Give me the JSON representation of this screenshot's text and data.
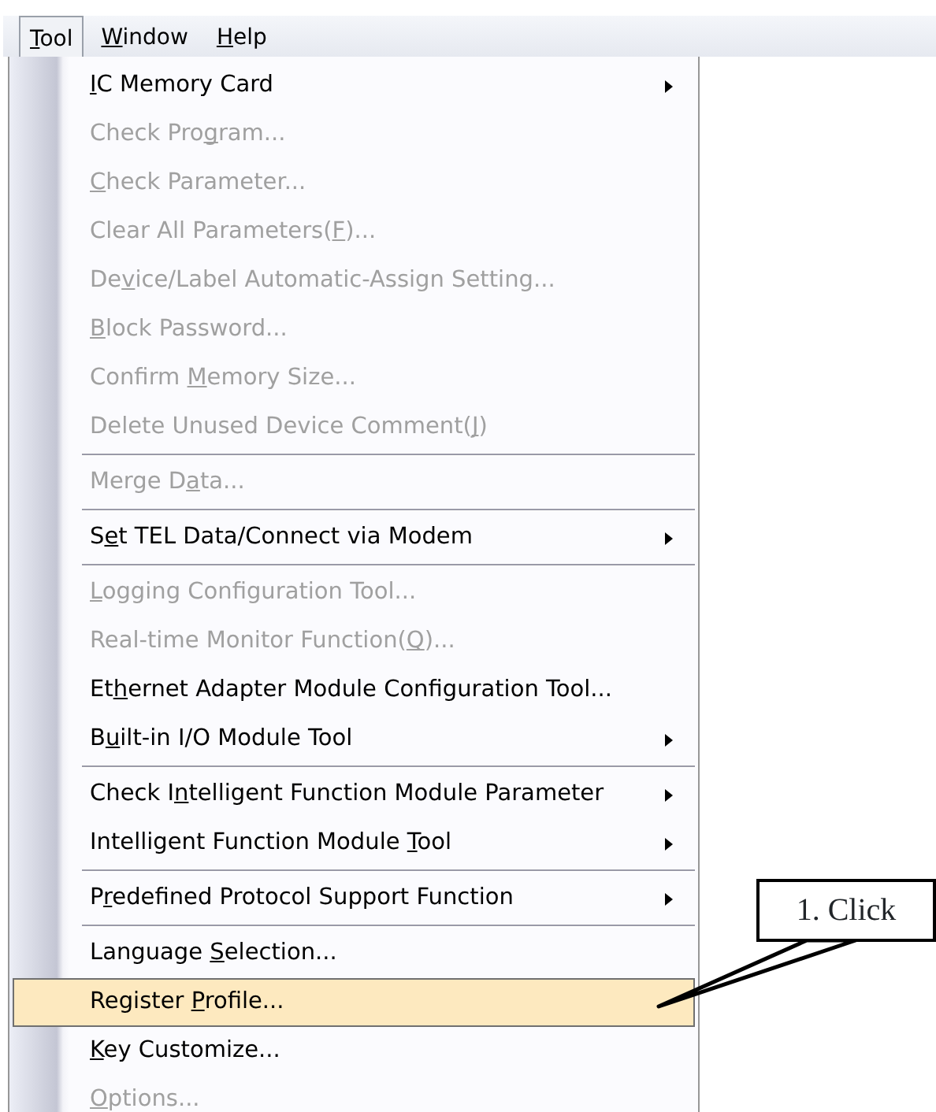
{
  "menu_bar": [
    {
      "parts": [
        {
          "text": "T",
          "underlined": true
        },
        {
          "text": "ool",
          "underlined": false
        }
      ],
      "selected": true
    },
    {
      "parts": [
        {
          "text": "W",
          "underlined": true
        },
        {
          "text": "indow",
          "underlined": false
        }
      ],
      "selected": false
    },
    {
      "parts": [
        {
          "text": "H",
          "underlined": true
        },
        {
          "text": "elp",
          "underlined": false
        }
      ],
      "selected": false
    }
  ],
  "menu": {
    "items": [
      {
        "kind": "item",
        "parts": [
          {
            "text": "I",
            "underlined": true
          },
          {
            "text": "C Memory Card",
            "underlined": false
          }
        ],
        "disabled": false,
        "submenu": true,
        "selected": false
      },
      {
        "kind": "item",
        "parts": [
          {
            "text": "Check Pro",
            "underlined": false
          },
          {
            "text": "g",
            "underlined": true
          },
          {
            "text": "ram...",
            "underlined": false
          }
        ],
        "disabled": true,
        "submenu": false,
        "selected": false
      },
      {
        "kind": "item",
        "parts": [
          {
            "text": "C",
            "underlined": true
          },
          {
            "text": "heck Parameter...",
            "underlined": false
          }
        ],
        "disabled": true,
        "submenu": false,
        "selected": false
      },
      {
        "kind": "item",
        "parts": [
          {
            "text": "Clear All Parameters(",
            "underlined": false
          },
          {
            "text": "F",
            "underlined": true
          },
          {
            "text": ")...",
            "underlined": false
          }
        ],
        "disabled": true,
        "submenu": false,
        "selected": false
      },
      {
        "kind": "item",
        "parts": [
          {
            "text": "De",
            "underlined": false
          },
          {
            "text": "v",
            "underlined": true
          },
          {
            "text": "ice/Label Automatic-Assign Setting...",
            "underlined": false
          }
        ],
        "disabled": true,
        "submenu": false,
        "selected": false
      },
      {
        "kind": "item",
        "parts": [
          {
            "text": "B",
            "underlined": true
          },
          {
            "text": "lock Password...",
            "underlined": false
          }
        ],
        "disabled": true,
        "submenu": false,
        "selected": false
      },
      {
        "kind": "item",
        "parts": [
          {
            "text": "Confirm ",
            "underlined": false
          },
          {
            "text": "M",
            "underlined": true
          },
          {
            "text": "emory Size...",
            "underlined": false
          }
        ],
        "disabled": true,
        "submenu": false,
        "selected": false
      },
      {
        "kind": "item",
        "parts": [
          {
            "text": "Delete Unused Device Comment(",
            "underlined": false
          },
          {
            "text": "J",
            "underlined": true
          },
          {
            "text": ")",
            "underlined": false
          }
        ],
        "disabled": true,
        "submenu": false,
        "selected": false
      },
      {
        "kind": "separator"
      },
      {
        "kind": "item",
        "parts": [
          {
            "text": "Merge D",
            "underlined": false
          },
          {
            "text": "a",
            "underlined": true
          },
          {
            "text": "ta...",
            "underlined": false
          }
        ],
        "disabled": true,
        "submenu": false,
        "selected": false
      },
      {
        "kind": "separator"
      },
      {
        "kind": "item",
        "parts": [
          {
            "text": "S",
            "underlined": false
          },
          {
            "text": "e",
            "underlined": true
          },
          {
            "text": "t TEL Data/Connect via Modem",
            "underlined": false
          }
        ],
        "disabled": false,
        "submenu": true,
        "selected": false
      },
      {
        "kind": "separator"
      },
      {
        "kind": "item",
        "parts": [
          {
            "text": "L",
            "underlined": true
          },
          {
            "text": "ogging Configuration Tool...",
            "underlined": false
          }
        ],
        "disabled": true,
        "submenu": false,
        "selected": false
      },
      {
        "kind": "item",
        "parts": [
          {
            "text": "Real-time Monitor Function(",
            "underlined": false
          },
          {
            "text": "Q",
            "underlined": true
          },
          {
            "text": ")...",
            "underlined": false
          }
        ],
        "disabled": true,
        "submenu": false,
        "selected": false
      },
      {
        "kind": "item",
        "parts": [
          {
            "text": "Et",
            "underlined": false
          },
          {
            "text": "h",
            "underlined": true
          },
          {
            "text": "ernet Adapter Module Configuration Tool...",
            "underlined": false
          }
        ],
        "disabled": false,
        "submenu": false,
        "selected": false
      },
      {
        "kind": "item",
        "parts": [
          {
            "text": "B",
            "underlined": false
          },
          {
            "text": "u",
            "underlined": true
          },
          {
            "text": "ilt-in I/O Module Tool",
            "underlined": false
          }
        ],
        "disabled": false,
        "submenu": true,
        "selected": false
      },
      {
        "kind": "separator"
      },
      {
        "kind": "item",
        "parts": [
          {
            "text": "Check I",
            "underlined": false
          },
          {
            "text": "n",
            "underlined": true
          },
          {
            "text": "telligent Function Module Parameter",
            "underlined": false
          }
        ],
        "disabled": false,
        "submenu": true,
        "selected": false
      },
      {
        "kind": "item",
        "parts": [
          {
            "text": "Intelligent Function Module ",
            "underlined": false
          },
          {
            "text": "T",
            "underlined": true
          },
          {
            "text": "ool",
            "underlined": false
          }
        ],
        "disabled": false,
        "submenu": true,
        "selected": false
      },
      {
        "kind": "separator"
      },
      {
        "kind": "item",
        "parts": [
          {
            "text": "P",
            "underlined": false
          },
          {
            "text": "r",
            "underlined": true
          },
          {
            "text": "edefined Protocol Support Function",
            "underlined": false
          }
        ],
        "disabled": false,
        "submenu": true,
        "selected": false
      },
      {
        "kind": "separator"
      },
      {
        "kind": "item",
        "parts": [
          {
            "text": "Language ",
            "underlined": false
          },
          {
            "text": "S",
            "underlined": true
          },
          {
            "text": "election...",
            "underlined": false
          }
        ],
        "disabled": false,
        "submenu": false,
        "selected": false
      },
      {
        "kind": "item",
        "parts": [
          {
            "text": "Register ",
            "underlined": false
          },
          {
            "text": "P",
            "underlined": true
          },
          {
            "text": "rofile...",
            "underlined": false
          }
        ],
        "disabled": false,
        "submenu": false,
        "selected": true
      },
      {
        "kind": "item",
        "parts": [
          {
            "text": "K",
            "underlined": true
          },
          {
            "text": "ey Customize...",
            "underlined": false
          }
        ],
        "disabled": false,
        "submenu": false,
        "selected": false
      },
      {
        "kind": "item",
        "parts": [
          {
            "text": "O",
            "underlined": true
          },
          {
            "text": "ptions...",
            "underlined": false
          }
        ],
        "disabled": true,
        "submenu": false,
        "selected": false
      }
    ]
  },
  "callout": {
    "text": "1. Click"
  }
}
